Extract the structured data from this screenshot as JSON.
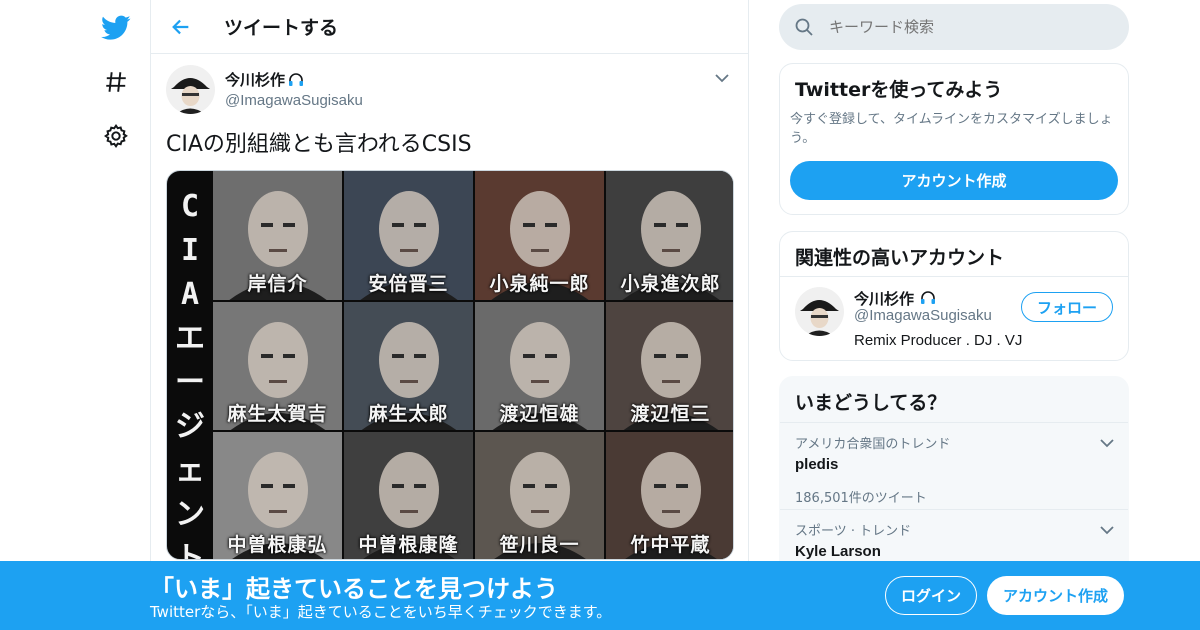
{
  "colors": {
    "accent": "#1da1f2",
    "text": "#14171a",
    "muted": "#657786",
    "border": "#e6ecf0"
  },
  "nav": {
    "logo_icon": "twitter-bird-icon",
    "explore_icon": "hashtag-icon",
    "settings_icon": "gear-icon"
  },
  "header": {
    "back_icon": "arrow-left-icon",
    "title": "ツイートする"
  },
  "tweet": {
    "display_name": "今川杉作",
    "name_badge_icon": "headphones-icon",
    "handle": "@ImagawaSugisaku",
    "menu_icon": "chevron-down-icon",
    "text": "CIAの別組織とも言われるCSIS",
    "media": {
      "vertical_title": [
        "C",
        "I",
        "A",
        "エ",
        "ー",
        "ジ",
        "ェ",
        "ン",
        "ト"
      ],
      "portraits": [
        "岸信介",
        "安倍晋三",
        "小泉純一郎",
        "小泉進次郎",
        "麻生太賀吉",
        "麻生太郎",
        "渡辺恒雄",
        "渡辺恒三",
        "中曽根康弘",
        "中曽根康隆",
        "笹川良一",
        "竹中平蔵"
      ]
    }
  },
  "search": {
    "placeholder": "キーワード検索",
    "icon": "search-icon"
  },
  "try_card": {
    "title": "Twitterを使ってみよう",
    "description": "今すぐ登録して、タイムラインをカスタマイズしましょう。",
    "button": "アカウント作成"
  },
  "related": {
    "title": "関連性の高いアカウント",
    "name": "今川杉作",
    "handle": "@ImagawaSugisaku",
    "bio": "Remix Producer . DJ . VJ",
    "follow_button": "フォロー"
  },
  "trends": {
    "title": "いまどうしてる？",
    "items": [
      {
        "meta": "アメリカ合衆国のトレンド",
        "name": "pledis",
        "count": "186,501件のツイート"
      },
      {
        "meta": "スポーツ · トレンド",
        "name": "Kyle Larson",
        "count": ""
      }
    ]
  },
  "banner": {
    "title": "「いま」起きていることを見つけよう",
    "subtitle": "Twitterなら、「いま」起きていることをいち早くチェックできます。",
    "login_button": "ログイン",
    "signup_button": "アカウント作成"
  }
}
